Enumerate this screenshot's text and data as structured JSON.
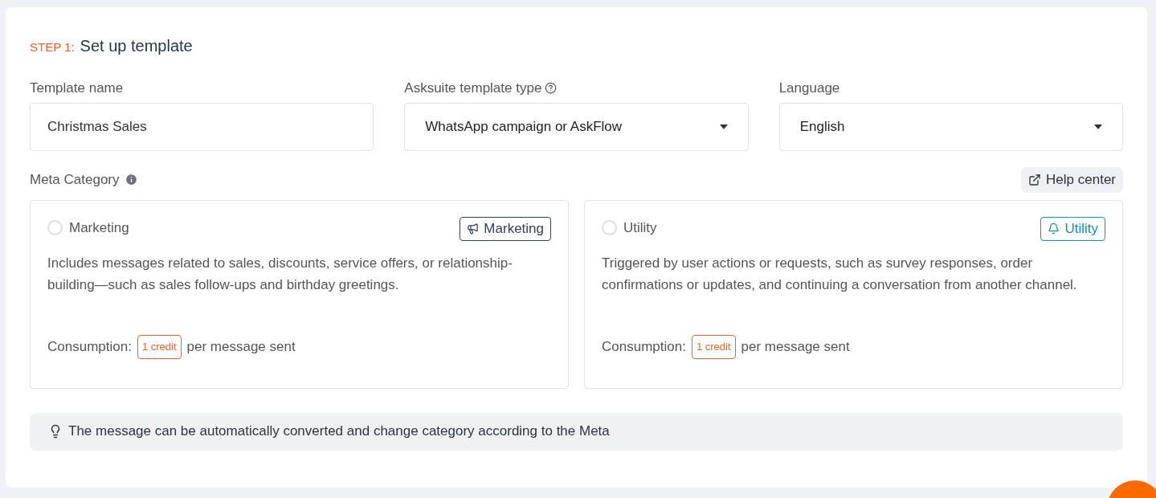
{
  "step": {
    "label": "STEP 1:",
    "title": "Set up template"
  },
  "fields": [
    {
      "label": "Template name",
      "kind": "text",
      "value": "Christmas Sales",
      "help": false
    },
    {
      "label": "Asksuite template type",
      "kind": "select",
      "value": "WhatsApp campaign or AskFlow",
      "help": true
    },
    {
      "label": "Language",
      "kind": "select",
      "value": "English",
      "help": false
    }
  ],
  "meta_category": {
    "label": "Meta Category",
    "help_center": "Help center"
  },
  "categories": [
    {
      "kind": "marketing",
      "name": "Marketing",
      "selected": false,
      "badge": "Marketing",
      "color": "#334155",
      "description": "Includes messages related to sales, discounts, service offers, or relationship-building—such as sales follow-ups and birthday greetings.",
      "consumption_label": "Consumption:",
      "credit": "1 credit",
      "consumption_suffix": "per message sent"
    },
    {
      "kind": "utility",
      "name": "Utility",
      "selected": false,
      "badge": "Utility",
      "color": "#0e95b0",
      "description": "Triggered by user actions or requests, such as survey responses, order confirmations or updates, and continuing a conversation from another channel.",
      "consumption_label": "Consumption:",
      "credit": "1 credit",
      "consumption_suffix": "per message sent"
    }
  ],
  "notice": "The message can be automatically converted and change category according to the Meta"
}
